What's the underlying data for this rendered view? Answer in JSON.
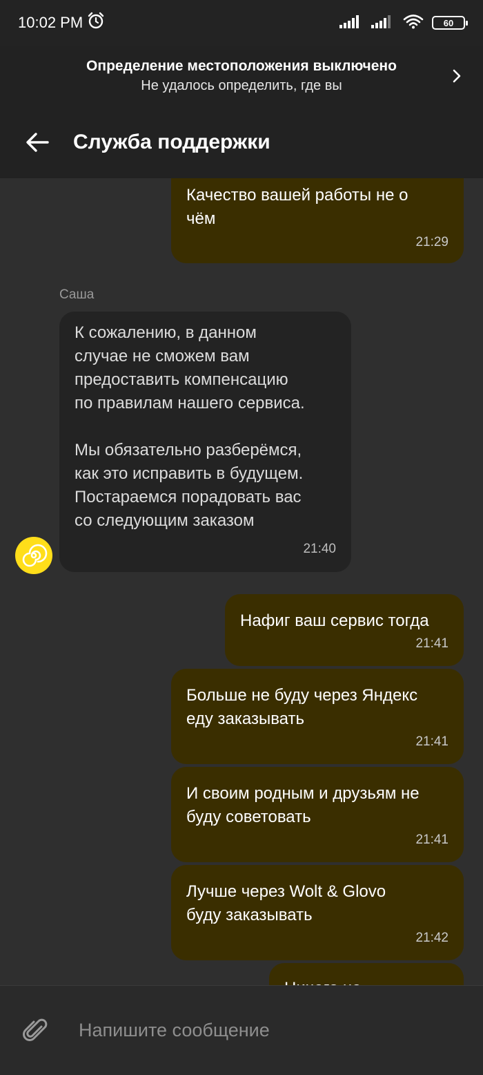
{
  "status_bar": {
    "time": "10:02 PM",
    "battery": "60"
  },
  "location_banner": {
    "title": "Определение местоположения выключено",
    "subtitle": "Не удалось определить, где вы"
  },
  "app_bar": {
    "title": "Служба поддержки"
  },
  "chat": {
    "sender_name": "Саша",
    "messages": [
      {
        "direction": "out",
        "text": "Качество вашей работы не о\nчём",
        "time": "21:29"
      },
      {
        "direction": "in",
        "text": "К сожалению, в данном\nслучае не сможем вам\nпредоставить компенсацию\nпо правилам нашего сервиса.\n\nМы обязательно разберёмся,\nкак это исправить в будущем.\nПостараемся порадовать вас\nсо следующим заказом",
        "time": "21:40"
      },
      {
        "direction": "out",
        "text": "Нафиг ваш сервис тогда",
        "time": "21:41"
      },
      {
        "direction": "out",
        "text": "Больше не буду через Яндекс\nеду заказывать",
        "time": "21:41"
      },
      {
        "direction": "out",
        "text": "И своим родным и друзьям не\nбуду советовать",
        "time": "21:41"
      },
      {
        "direction": "out",
        "text": "Лучше через Wolt & Glovo\nбуду заказывать",
        "time": "21:42"
      },
      {
        "direction": "out",
        "text": "Ничего не рекомендую",
        "time": ""
      }
    ]
  },
  "input": {
    "placeholder": "Напишите сообщение"
  },
  "colors": {
    "background": "#2f2f2f",
    "outgoing_bubble": "#3a2e00",
    "incoming_bubble": "#232323",
    "avatar": "#ffde1a"
  }
}
